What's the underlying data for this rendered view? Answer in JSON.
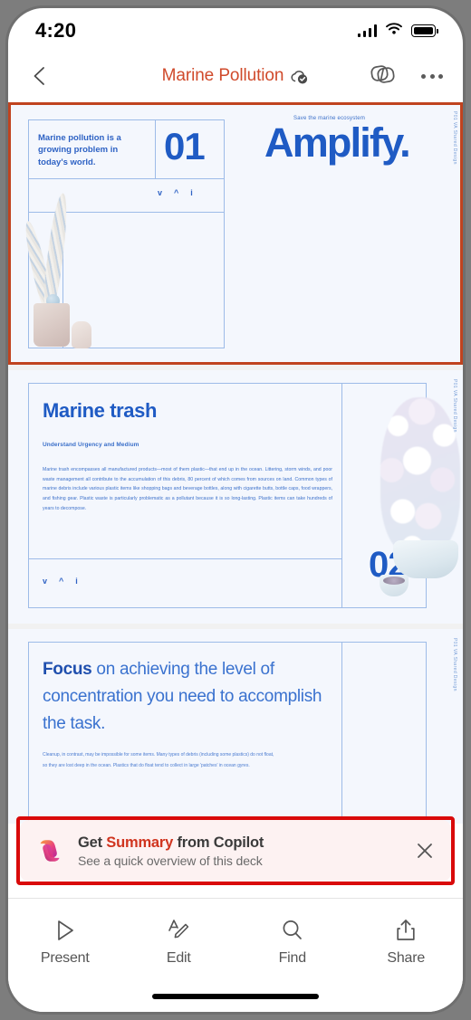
{
  "status_bar": {
    "time": "4:20",
    "cellular_icon": "cellular-signal-icon",
    "wifi_icon": "wifi-icon",
    "battery_icon": "battery-full-icon"
  },
  "nav_bar": {
    "back_icon": "back-chevron-icon",
    "title": "Marine Pollution",
    "sync_icon": "cloud-synced-check-icon",
    "copilot_icon": "copilot-pages-icon",
    "more_icon": "more-options-icon"
  },
  "deck": {
    "slides": [
      {
        "selected": true,
        "number": "01",
        "callout": "Marine pollution is a growing problem in today's world.",
        "chevrons": [
          "v",
          "^",
          "i"
        ],
        "side_label": "P01  VA Shared Design",
        "tagline": "Save the marine ecosystem",
        "brand": "Amplify.",
        "image_name": "coral-in-pot-photo"
      },
      {
        "selected": false,
        "number": "02",
        "title": "Marine trash",
        "subtitle": "Understand Urgency and Medium",
        "body": "Marine trash encompasses all manufactured products—most of them plastic—that end up in the ocean. Littering, storm winds, and poor waste management all contribute to the accumulation of this debris, 80 percent of which comes from sources on land. Common types of marine debris include various plastic items like shopping bags and beverage bottles, along with cigarette butts, bottle caps, food wrappers, and fishing gear. Plastic waste is particularly problematic as a pollutant because it is so long-lasting. Plastic items can take hundreds of years to decompose.",
        "chevrons": [
          "v",
          "^",
          "i"
        ],
        "side_label": "P01  VA Shared Design",
        "image_name": "white-coral-in-bowl-photo"
      },
      {
        "selected": false,
        "headline_lead": "Focus",
        "headline_rest": " on achieving the level of concentration you need to accomplish the task.",
        "body": "Cleanup, in contrast, may be impossible for some items. Many types of debris (including some plastics) do not float, so they are lost deep in the ocean. Plastics that do float tend to collect in large 'patches' in ocean gyres.",
        "side_label": "P01  VA Shared Design"
      }
    ]
  },
  "copilot_banner": {
    "selected": true,
    "logo_icon": "copilot-logo-icon",
    "title_lead": "Get ",
    "title_highlight": "Summary",
    "title_rest": " from Copilot",
    "subtitle": "See a quick overview of this deck",
    "close_icon": "close-icon"
  },
  "toolbar": {
    "items": [
      {
        "icon": "play-triangle-icon",
        "label": "Present"
      },
      {
        "icon": "edit-pen-icon",
        "label": "Edit"
      },
      {
        "icon": "search-magnifier-icon",
        "label": "Find"
      },
      {
        "icon": "share-upload-icon",
        "label": "Share"
      }
    ]
  },
  "colors": {
    "accent_title": "#D04A2B",
    "slide_selection": "#C0431F",
    "banner_selection": "#D90A0A",
    "slide_blue": "#1F5BC4",
    "copilot_red": "#D0341F"
  }
}
